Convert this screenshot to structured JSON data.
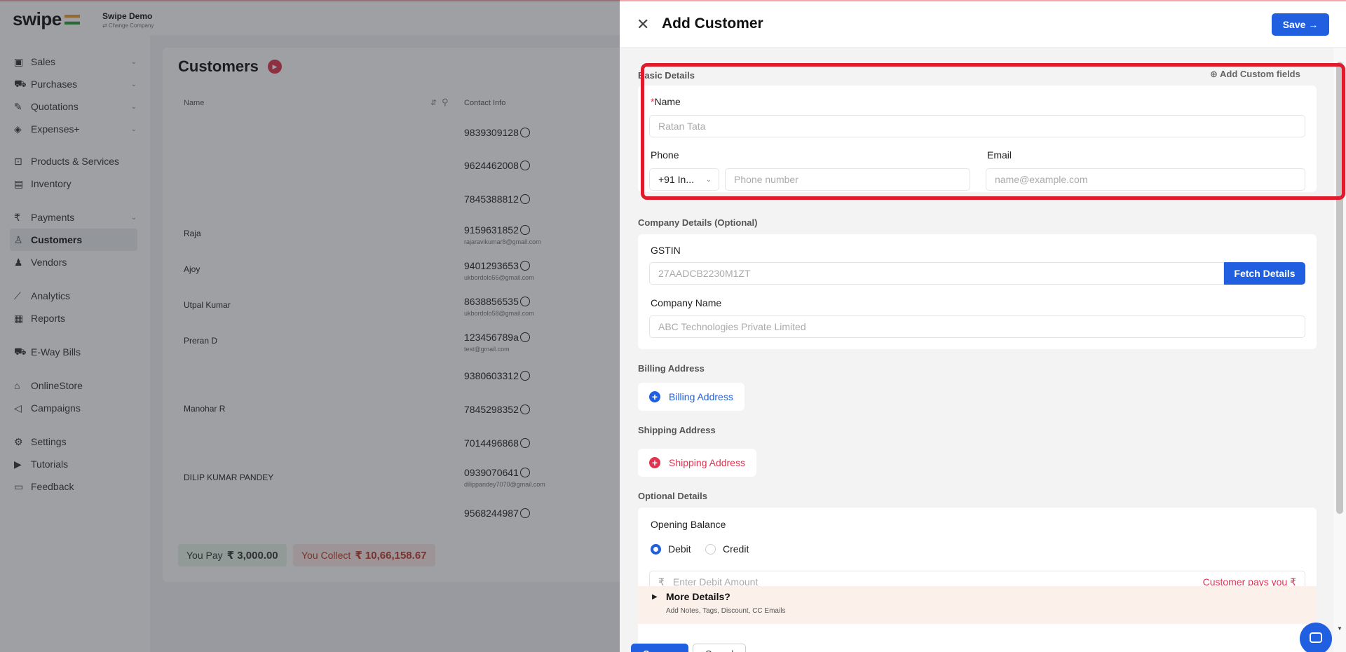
{
  "app": {
    "logo": "swipe",
    "company_name": "Swipe Demo",
    "company_change": "⇄ Change Company"
  },
  "sidebar": {
    "items": [
      {
        "label": "Sales",
        "icon": "sales-icon",
        "glyph": "▣",
        "chevron": "⌄"
      },
      {
        "label": "Purchases",
        "icon": "cart-icon",
        "glyph": "⛟",
        "chevron": "⌄"
      },
      {
        "label": "Quotations",
        "icon": "pen-icon",
        "glyph": "✎",
        "chevron": "⌄"
      },
      {
        "label": "Expenses+",
        "icon": "tag-icon",
        "glyph": "◈",
        "chevron": "⌄"
      },
      {
        "label": "Products & Services",
        "icon": "products-icon",
        "glyph": "⊡",
        "chevron": ""
      },
      {
        "label": "Inventory",
        "icon": "inventory-icon",
        "glyph": "▤",
        "chevron": ""
      },
      {
        "label": "Payments",
        "icon": "rupee-icon",
        "glyph": "₹",
        "chevron": "⌄"
      },
      {
        "label": "Customers",
        "icon": "user-icon",
        "glyph": "♙",
        "chevron": ""
      },
      {
        "label": "Vendors",
        "icon": "users-icon",
        "glyph": "♟",
        "chevron": ""
      },
      {
        "label": "Analytics",
        "icon": "analytics-icon",
        "glyph": "⟋",
        "chevron": ""
      },
      {
        "label": "Reports",
        "icon": "reports-icon",
        "glyph": "▦",
        "chevron": ""
      },
      {
        "label": "E-Way Bills",
        "icon": "truck-icon",
        "glyph": "⛟",
        "chevron": ""
      },
      {
        "label": "OnlineStore",
        "icon": "store-icon",
        "glyph": "⌂",
        "chevron": ""
      },
      {
        "label": "Campaigns",
        "icon": "megaphone-icon",
        "glyph": "◁",
        "chevron": ""
      },
      {
        "label": "Settings",
        "icon": "gear-icon",
        "glyph": "⚙",
        "chevron": ""
      },
      {
        "label": "Tutorials",
        "icon": "video-icon",
        "glyph": "▶",
        "chevron": ""
      },
      {
        "label": "Feedback",
        "icon": "feedback-icon",
        "glyph": "▭",
        "chevron": ""
      }
    ]
  },
  "customers": {
    "title": "Customers",
    "col_name": "Name",
    "col_contact": "Contact Info",
    "rows": [
      {
        "name": "",
        "phone": "9839309128",
        "email": ""
      },
      {
        "name": "",
        "phone": "9624462008",
        "email": ""
      },
      {
        "name": "",
        "phone": "7845388812",
        "email": ""
      },
      {
        "name": "Raja",
        "phone": "9159631852",
        "email": "rajaravikumar8@gmail.com"
      },
      {
        "name": "Ajoy",
        "phone": "9401293653",
        "email": "ukbordolo56@gmail.com"
      },
      {
        "name": "Utpal Kumar",
        "phone": "8638856535",
        "email": "ukbordolo58@gmail.com"
      },
      {
        "name": "Preran D",
        "phone": "123456789a",
        "email": "test@gmail.com"
      },
      {
        "name": "",
        "phone": "9380603312",
        "email": ""
      },
      {
        "name": "Manohar R",
        "phone": "7845298352",
        "email": ""
      },
      {
        "name": "",
        "phone": "7014496868",
        "email": ""
      },
      {
        "name": "DILIP KUMAR PANDEY",
        "phone": "0939070641",
        "email": "dilippandey7070@gmail.com"
      },
      {
        "name": "",
        "phone": "9568244987",
        "email": ""
      }
    ],
    "you_pay_label": "You Pay",
    "you_pay_value": "₹ 3,000.00",
    "you_collect_label": "You Collect",
    "you_collect_value": "₹ 10,66,158.67"
  },
  "drawer": {
    "title": "Add Customer",
    "save_label": "Save →",
    "basic_details": {
      "section_label": "Basic Details",
      "add_custom_fields": "⊕ Add Custom fields",
      "name_label": "Name",
      "name_required": "*",
      "name_placeholder": "Ratan Tata",
      "phone_label": "Phone",
      "country_code": "+91  In...",
      "phone_placeholder": "Phone number",
      "email_label": "Email",
      "email_placeholder": "name@example.com"
    },
    "company_details": {
      "section_label": "Company Details (Optional)",
      "gstin_label": "GSTIN",
      "gstin_placeholder": "27AADCB2230M1ZT",
      "fetch_label": "Fetch Details",
      "company_name_label": "Company Name",
      "company_name_placeholder": "ABC Technologies Private Limited"
    },
    "billing": {
      "section_label": "Billing Address",
      "button_label": "Billing Address"
    },
    "shipping": {
      "section_label": "Shipping Address",
      "button_label": "Shipping Address"
    },
    "optional": {
      "section_label": "Optional Details",
      "opening_balance_label": "Opening Balance",
      "debit_label": "Debit",
      "credit_label": "Credit",
      "selected": "Debit",
      "amount_placeholder": "Enter Debit Amount",
      "customer_pays_you": "Customer pays you ₹",
      "more_details_title": "More Details?",
      "more_details_sub": "Add Notes, Tags, Discount, CC Emails",
      "field_zero": "0"
    },
    "bottom_save": "Save →",
    "bottom_cancel": "Cancel"
  },
  "colors": {
    "primary": "#1f5fe0",
    "highlight": "#e01b2c",
    "danger": "#e0334f"
  }
}
